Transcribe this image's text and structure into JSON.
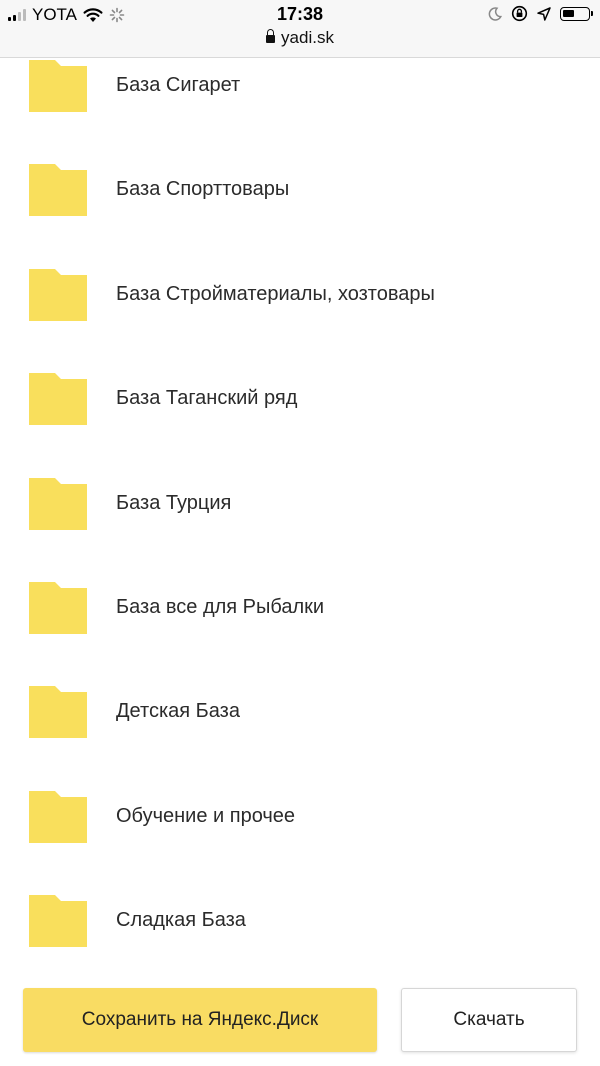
{
  "status_bar": {
    "carrier": "YOTA",
    "time": "17:38",
    "url": "yadi.sk",
    "icons": [
      "signal-icon",
      "wifi-icon",
      "activity-spinner-icon",
      "moon-icon",
      "rotation-lock-icon",
      "location-arrow-icon",
      "battery-icon"
    ]
  },
  "folders": [
    {
      "label": "База Сигарет",
      "icon": "folder-icon"
    },
    {
      "label": "База Спорттовары",
      "icon": "folder-icon"
    },
    {
      "label": "База Стройматериалы, хозтовары",
      "icon": "folder-icon"
    },
    {
      "label": "База Таганский ряд",
      "icon": "folder-icon"
    },
    {
      "label": "База Турция",
      "icon": "folder-icon"
    },
    {
      "label": "База все для Рыбалки",
      "icon": "folder-icon"
    },
    {
      "label": "Детская База",
      "icon": "folder-icon"
    },
    {
      "label": "Обучение и прочее",
      "icon": "folder-icon"
    },
    {
      "label": "Сладкая База",
      "icon": "folder-icon"
    }
  ],
  "actions": {
    "save_label": "Сохранить на Яндекс.Диск",
    "download_label": "Скачать"
  },
  "colors": {
    "folder": "#f9df5c",
    "save_button": "#f9dc63"
  }
}
